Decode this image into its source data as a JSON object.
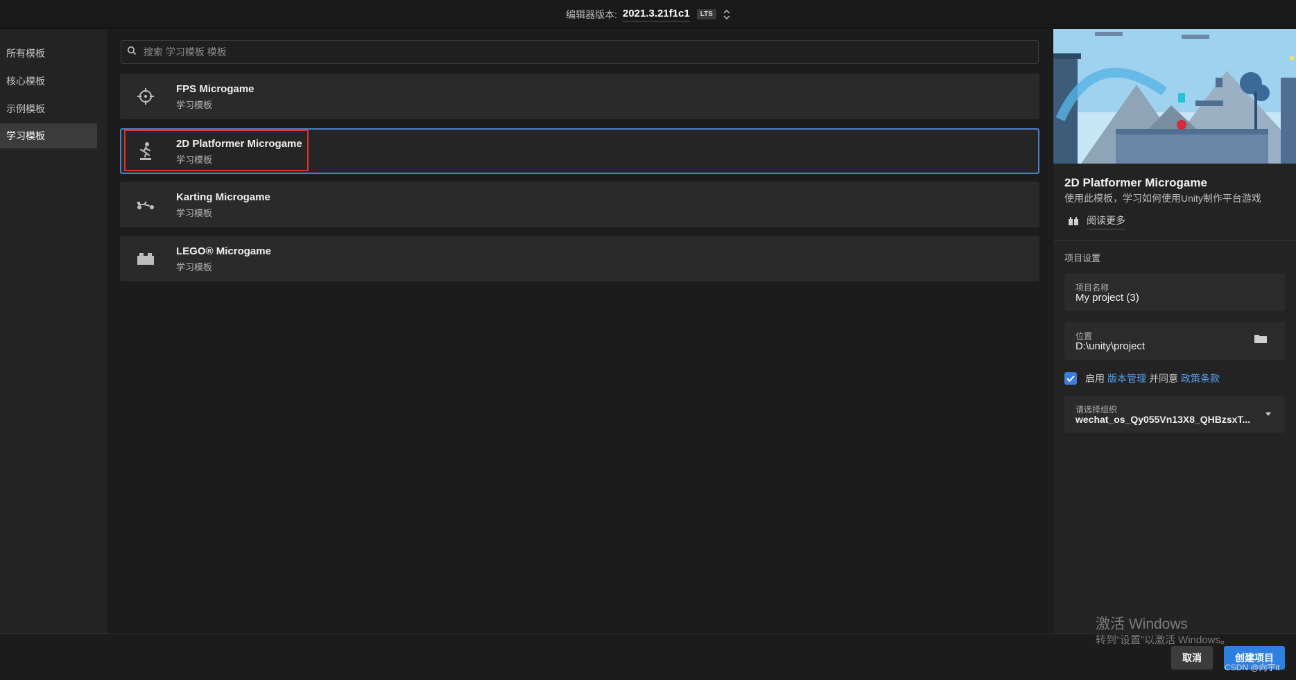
{
  "topbar": {
    "version_label": "编辑器版本:",
    "version_value": "2021.3.21f1c1",
    "lts_badge": "LTS"
  },
  "sidebar": {
    "items": [
      {
        "label": "所有模板",
        "active": false
      },
      {
        "label": "核心模板",
        "active": false
      },
      {
        "label": "示例模板",
        "active": false
      },
      {
        "label": "学习模板",
        "active": true
      }
    ]
  },
  "search": {
    "placeholder": "搜索 学习模板 模板",
    "value": ""
  },
  "templates": [
    {
      "title": "FPS Microgame",
      "subtitle": "学习模板",
      "icon": "crosshair-icon"
    },
    {
      "title": "2D Platformer Microgame",
      "subtitle": "学习模板",
      "icon": "runner-icon",
      "selected": true
    },
    {
      "title": "Karting Microgame",
      "subtitle": "学习模板",
      "icon": "kart-icon"
    },
    {
      "title": "LEGO® Microgame",
      "subtitle": "学习模板",
      "icon": "lego-brick-icon"
    }
  ],
  "details": {
    "title": "2D Platformer Microgame",
    "description": "使用此模板，学习如何使用Unity制作平台游戏",
    "read_more": "阅读更多",
    "section_title": "项目设置",
    "project_name_label": "项目名称",
    "project_name_value": "My project (3)",
    "location_label": "位置",
    "location_value": "D:\\unity\\project",
    "consent_prefix": "启用",
    "consent_link1": "版本管理",
    "consent_middle": "并同意",
    "consent_link2": "政策条款",
    "consent_checked": true,
    "org_label": "请选择组织",
    "org_value": "wechat_os_Qy055Vn13X8_QHBzsxT..."
  },
  "footer": {
    "cancel_label": "取消",
    "create_label": "创建项目"
  },
  "overlay": {
    "activate_title": "激活 Windows",
    "activate_sub": "转到“设置”以激活 Windows。",
    "csdn": "CSDN @向宇it"
  },
  "colors": {
    "accent": "#2d7fe0",
    "selection_border": "#4d7fc0",
    "annotation_red": "#e03030"
  }
}
